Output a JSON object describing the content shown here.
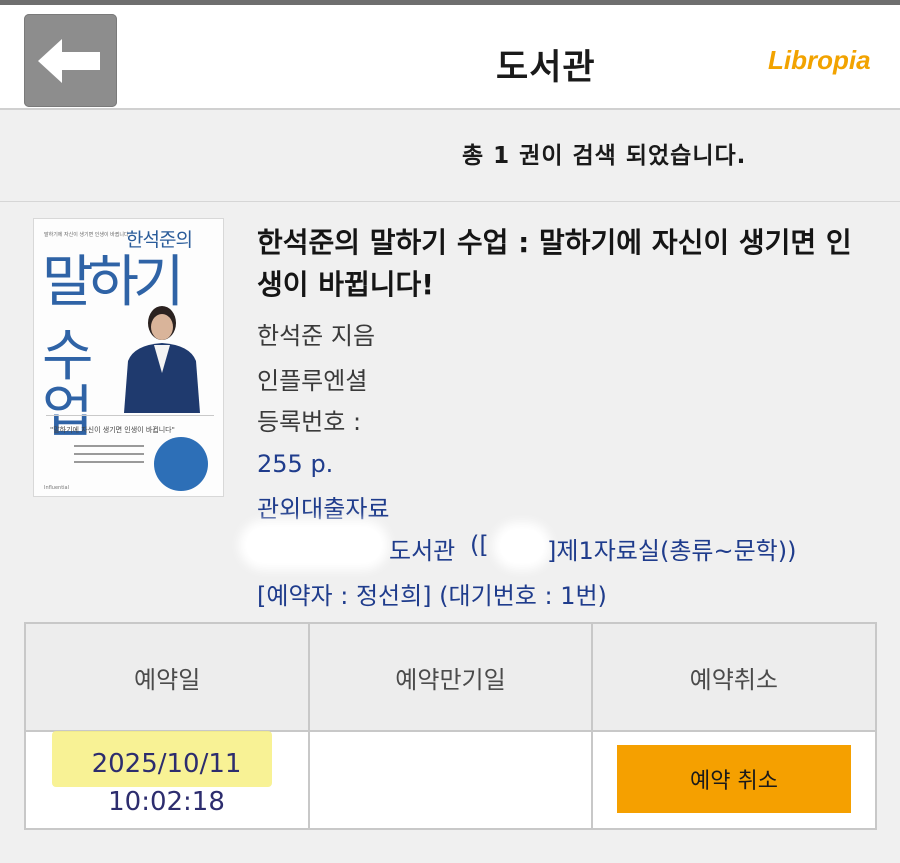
{
  "header": {
    "back_icon": "back-arrow-icon",
    "title": "도서관",
    "logo": "Libropia"
  },
  "search": {
    "result_count_text": "총 1 권이 검색 되었습니다."
  },
  "book": {
    "cover": {
      "top_text": "말하기에 자신이 생기면 인생이 바뀝니다",
      "author_text": "한석준의",
      "big_title_1": "말하기",
      "big_title_2": "수업",
      "quote": "\"말하기에 자신이 생기면 인생이 바뀝니다\"",
      "publisher": "Influential"
    },
    "title": "한석준의 말하기 수업 : 말하기에 자신이 생기면 인생이 바뀝니다!",
    "author": "한석준 지음",
    "publisher": "인플루엔셜",
    "registration_label": "등록번호 :",
    "pages": "255 p.",
    "loan_type": "관외대출자료",
    "location_library": "도서관",
    "location_open": "([",
    "location_room": "]제1자료실(총류~문학))",
    "reservation": "[예약자 : 정선희] (대기번호 : 1번)"
  },
  "reservation_table": {
    "headers": [
      "예약일",
      "예약만기일",
      "예약취소"
    ],
    "reserve_date": "2025/10/11",
    "reserve_time": "10:02:18",
    "expiry_date": "",
    "cancel_button": "예약 취소"
  },
  "colors": {
    "accent": "#f5a000",
    "logo": "#f2a300",
    "link_blue": "#1f3c8c",
    "highlight": "#f7f083"
  }
}
